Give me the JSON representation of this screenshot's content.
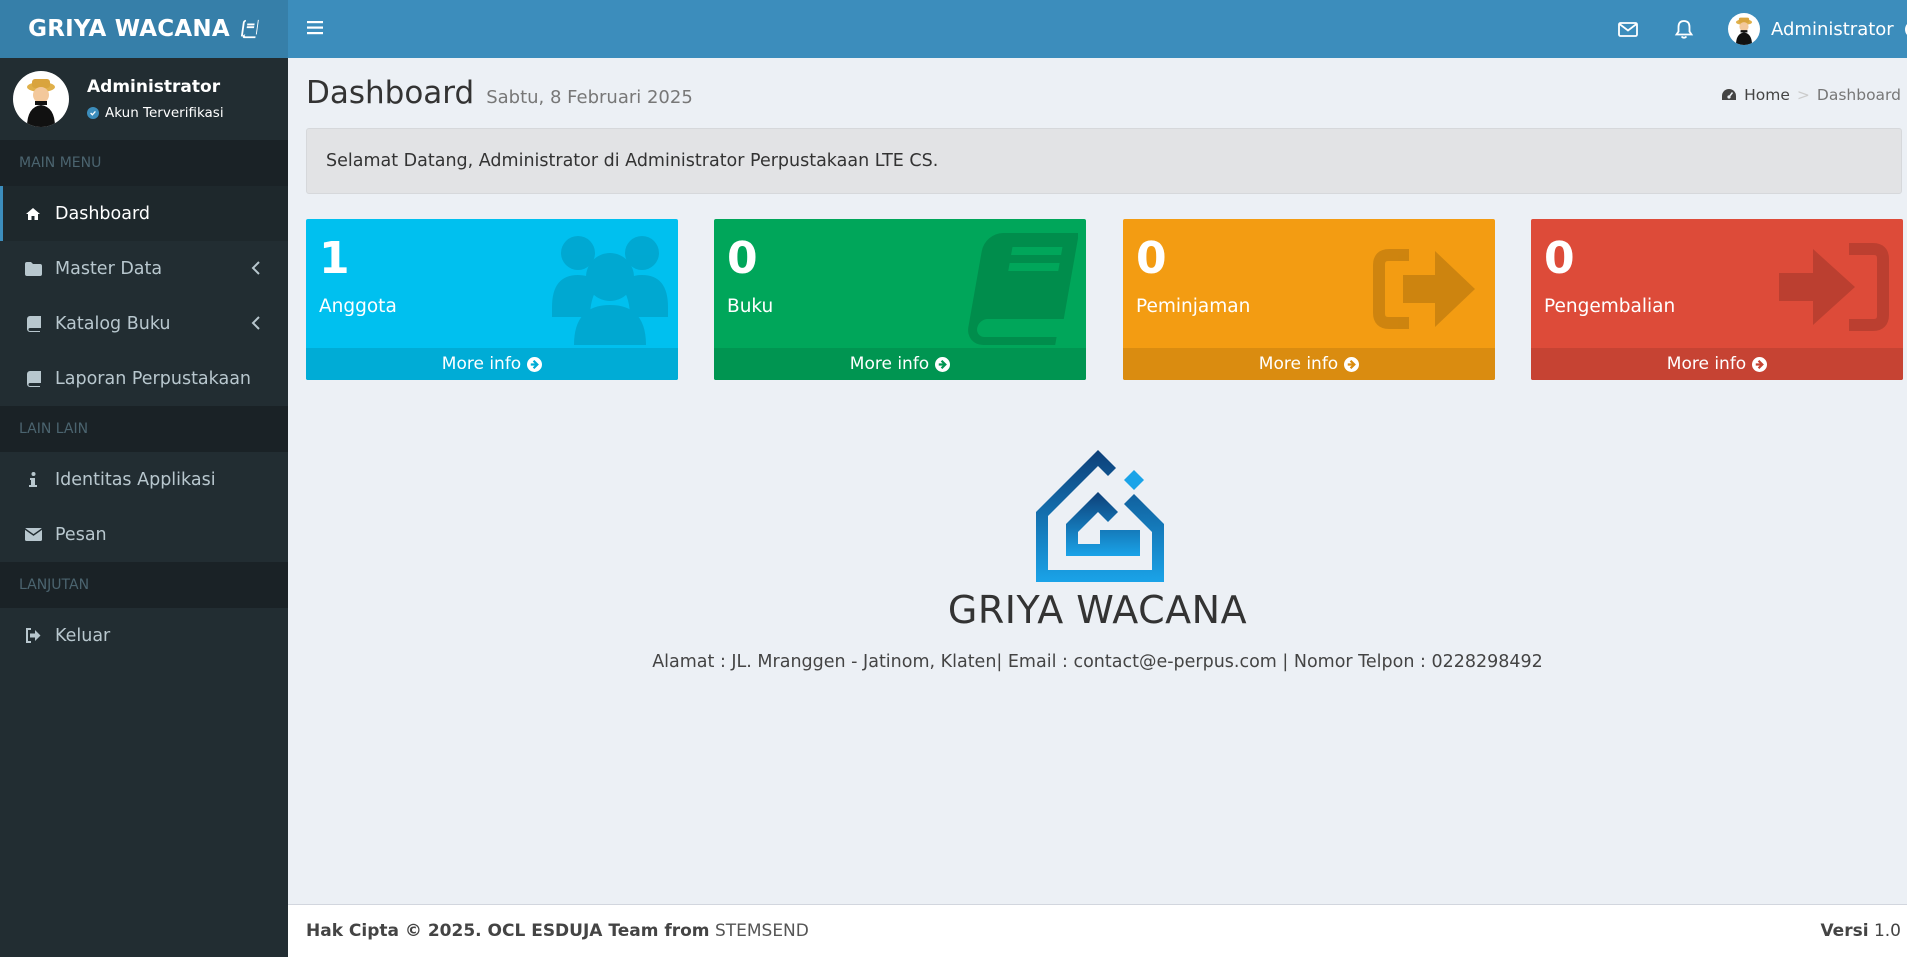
{
  "brand": {
    "name": "GRIYA WACANA"
  },
  "user_panel": {
    "name": "Administrator",
    "status": "Akun Terverifikasi"
  },
  "sidebar": {
    "sections": [
      {
        "header": "MAIN MENU",
        "items": [
          {
            "label": "Dashboard",
            "icon": "home-icon",
            "active": true
          },
          {
            "label": "Master Data",
            "icon": "folder-icon",
            "has_submenu": true
          },
          {
            "label": "Katalog Buku",
            "icon": "book-icon",
            "has_submenu": true
          },
          {
            "label": "Laporan Perpustakaan",
            "icon": "book-icon"
          }
        ]
      },
      {
        "header": "LAIN LAIN",
        "items": [
          {
            "label": "Identitas Applikasi",
            "icon": "info-icon"
          },
          {
            "label": "Pesan",
            "icon": "envelope-icon"
          }
        ]
      },
      {
        "header": "LANJUTAN",
        "items": [
          {
            "label": "Keluar",
            "icon": "sign-out-icon"
          }
        ]
      }
    ]
  },
  "navbar": {
    "user_name": "Administrator"
  },
  "page": {
    "title": "Dashboard",
    "date": "Sabtu, 8 Februari 2025"
  },
  "breadcrumb": {
    "home": "Home",
    "separator": ">",
    "current": "Dashboard"
  },
  "welcome": "Selamat Datang, Administrator di Administrator Perpustakaan LTE CS.",
  "stats": [
    {
      "value": "1",
      "label": "Anggota",
      "more": "More info",
      "icon": "users-icon",
      "color": "#00c0ef"
    },
    {
      "value": "0",
      "label": "Buku",
      "more": "More info",
      "icon": "book-icon",
      "color": "#00a65a"
    },
    {
      "value": "0",
      "label": "Peminjaman",
      "more": "More info",
      "icon": "sign-out-icon",
      "color": "#f39c12"
    },
    {
      "value": "0",
      "label": "Pengembalian",
      "more": "More info",
      "icon": "sign-in-icon",
      "color": "#dd4b39"
    }
  ],
  "center": {
    "title": "GRIYA WACANA",
    "address": "Alamat : JL. Mranggen - Jatinom, Klaten| Email : contact@e-perpus.com | Nomor Telpon : 0228298492"
  },
  "footer": {
    "copyright": "Hak Cipta © 2025. OCL ESDUJA Team from",
    "company": "STEMSEND",
    "version_label": "Versi",
    "version": "1.0"
  },
  "colors": {
    "brand": "#367fa9",
    "navbar": "#3c8dbc",
    "sidebar": "#222d32"
  }
}
